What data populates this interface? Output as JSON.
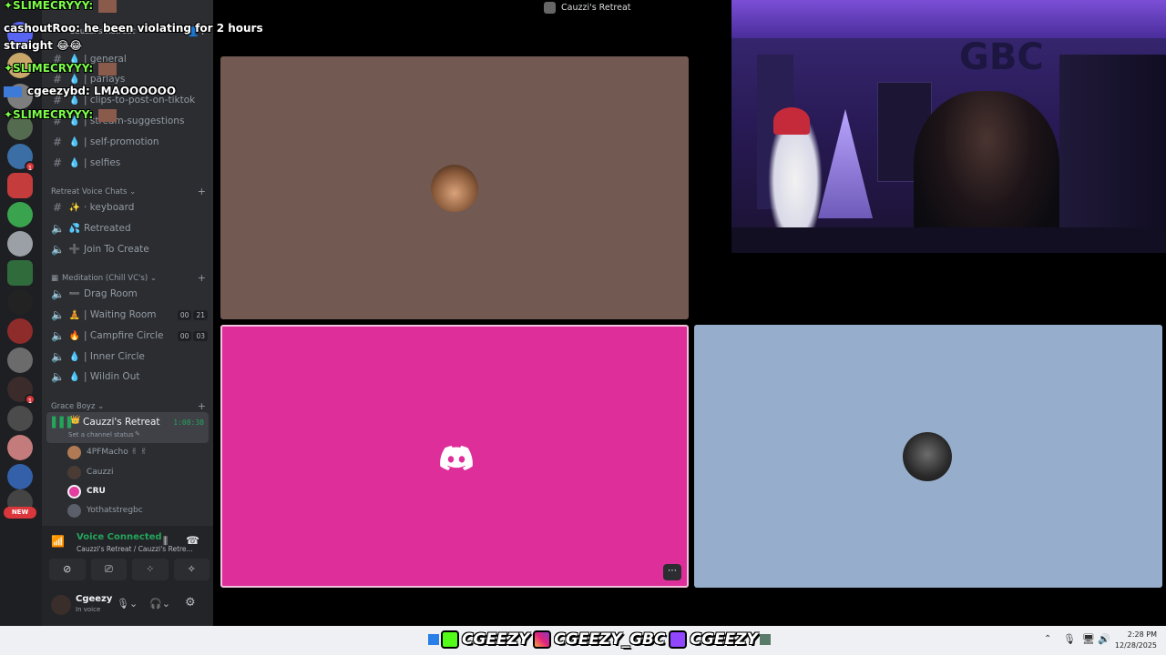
{
  "window": {
    "title": "Cauzzi's Retreat"
  },
  "sidebar": {
    "server_name": "Cauzzi's Retreat",
    "text_channels": [
      {
        "label": "| general",
        "emoji": "💧"
      },
      {
        "label": "| parlays",
        "emoji": "💧"
      },
      {
        "label": "| clips-to-post-on-tiktok",
        "emoji": "💧"
      },
      {
        "label": "| stream-suggestions",
        "emoji": "💧"
      },
      {
        "label": "| self-promotion",
        "emoji": "💧"
      },
      {
        "label": "| selfies",
        "emoji": "💧"
      }
    ],
    "categories": {
      "retreat_voice": "Retreat Voice Chats",
      "meditation": "Meditation (Chill VC's)",
      "grace_boyz": "Grace Boyz"
    },
    "retreat_channels": [
      {
        "label": "· keyboard",
        "emoji": "✨"
      },
      {
        "label": "Retreated",
        "emoji": "💦"
      },
      {
        "label": "Join To Create",
        "emoji": "➕"
      }
    ],
    "meditation_channels": [
      {
        "label": "Drag Room",
        "emoji": "➖",
        "counts": []
      },
      {
        "label": "| Waiting Room",
        "emoji": "🧘",
        "counts": [
          "00",
          "21"
        ]
      },
      {
        "label": "| Campfire Circle",
        "emoji": "🔥",
        "counts": [
          "00",
          "03"
        ]
      },
      {
        "label": "| Inner Circle",
        "emoji": "💧",
        "counts": []
      },
      {
        "label": "| Wildin Out",
        "emoji": "💧",
        "counts": []
      }
    ],
    "active_channel": {
      "label": "Cauzzi's Retreat",
      "timer": "1:08:38",
      "status": "Set a channel status"
    },
    "voice_users": [
      {
        "name": "4PFMacho ✌ ✌",
        "color": "#b07a55",
        "bold": false
      },
      {
        "name": "Cauzzi",
        "color": "#4a3b34",
        "bold": false
      },
      {
        "name": "CRU",
        "color": "#e23d9f",
        "bold": true
      },
      {
        "name": "Yothatstregbc",
        "color": "#5a5f6a",
        "bold": false
      }
    ],
    "new_label": "NEW",
    "voice_connected": {
      "title": "Voice Connected",
      "sub": "Cauzzi's Retreat / Cauzzi's Retre..."
    },
    "user": {
      "name": "Cgeezy",
      "status": "In voice"
    }
  },
  "chat": [
    {
      "name": "✦SLIMECRYYY:",
      "text": ""
    },
    {
      "name": "cashoutRoo:",
      "text": "he been violating for 2 hours"
    },
    {
      "name": "",
      "text": "straight 😂😂"
    },
    {
      "name": "✦SLIMECRYYY:",
      "text": ""
    },
    {
      "name": "cgeezybd:",
      "text": "LMAOOOOOO"
    },
    {
      "name": "✦SLIMECRYYY:",
      "text": ""
    }
  ],
  "tiles": [
    {
      "name": "tile-1",
      "bg": "#725a52"
    },
    {
      "name": "tile-2",
      "bg": "#de2e9a"
    },
    {
      "name": "tile-3",
      "bg": "#96aecb"
    }
  ],
  "taskbar": {
    "socials": [
      "CGEEZY",
      "CGEEZY_GBC",
      "CGEEZY"
    ],
    "time": "2:28 PM",
    "date": "12/28/2025"
  },
  "colors": {
    "discord_green": "#23a55a",
    "accent_pink": "#de2e9a",
    "kick_green": "#53fc18"
  }
}
